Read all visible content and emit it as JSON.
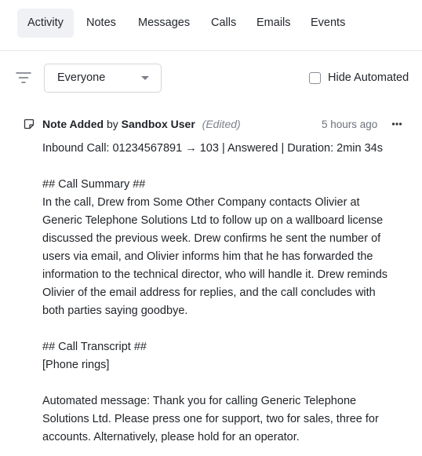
{
  "tabs": [
    {
      "label": "Activity",
      "active": true
    },
    {
      "label": "Notes",
      "active": false
    },
    {
      "label": "Messages",
      "active": false
    },
    {
      "label": "Calls",
      "active": false
    },
    {
      "label": "Emails",
      "active": false
    },
    {
      "label": "Events",
      "active": false
    }
  ],
  "filter": {
    "icon": "filter-lines-icon",
    "selected": "Everyone",
    "hide_automated_label": "Hide Automated",
    "hide_automated_checked": false
  },
  "item": {
    "type_label": "Note Added",
    "by_label": "by",
    "author": "Sandbox User",
    "edited": "(Edited)",
    "timestamp": "5 hours ago",
    "summary_line": "Inbound Call: 01234567891 → 103 | Answered | Duration: 2min 34s",
    "call_summary_heading": "## Call Summary ##",
    "call_summary_lines": [
      "In the call, Drew from Some Other Company contacts Olivier at",
      "Generic Telephone Solutions Ltd to follow up on a wallboard license",
      "discussed the previous week. Drew confirms he sent the number of",
      "users via email, and Olivier informs him that he has forwarded the",
      "information to the technical director, who will handle it. Drew reminds",
      "Olivier of the email address for replies, and the call concludes with",
      "both parties saying goodbye."
    ],
    "transcript_heading": "## Call Transcript ##",
    "transcript_first": "[Phone rings]",
    "transcript_lines": [
      "Automated message: Thank you for calling Generic Telephone",
      "Solutions Ltd. Please press one for support, two for sales, three for",
      "accounts. Alternatively, please hold for an operator."
    ]
  }
}
